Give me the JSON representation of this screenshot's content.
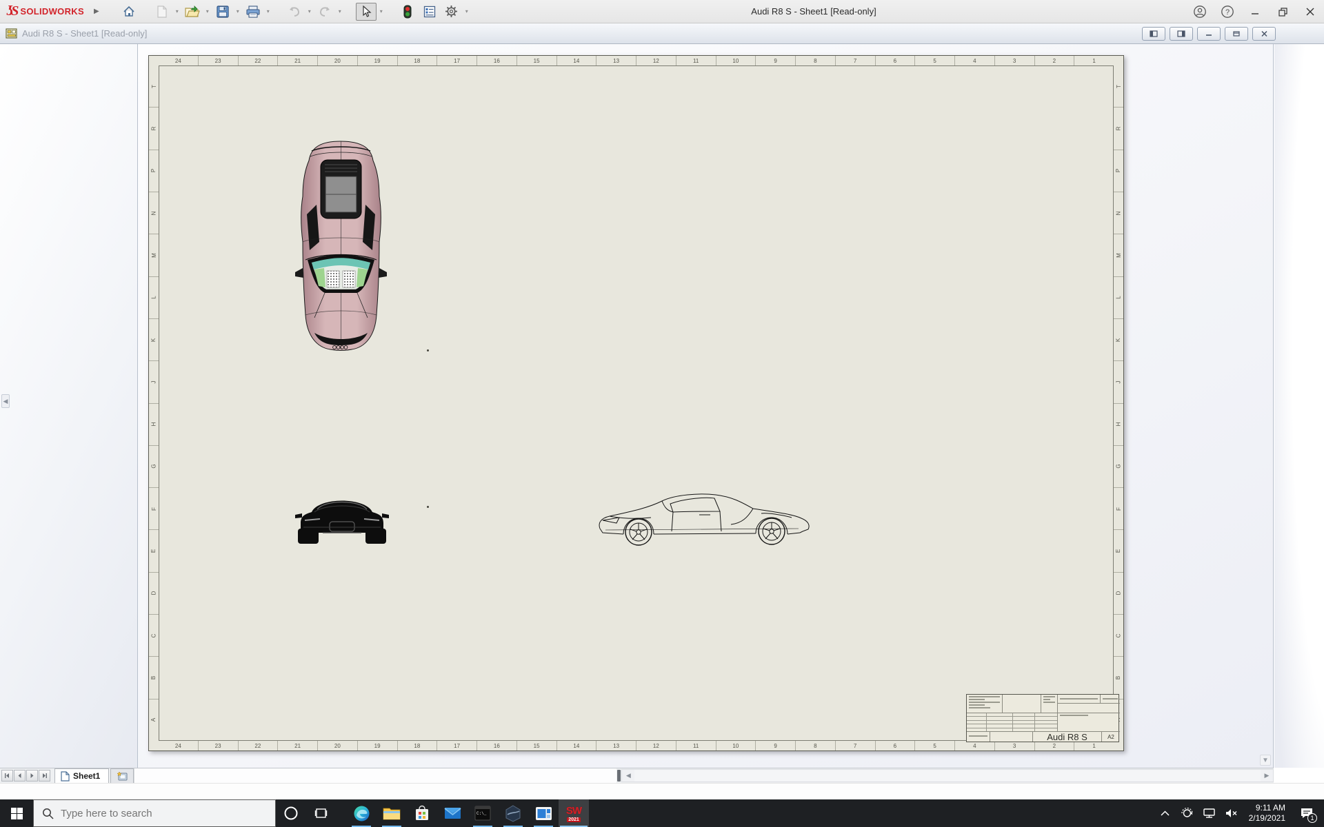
{
  "window": {
    "logo_text": "SOLIDWORKS",
    "title": "Audi R8 S - Sheet1 [Read-only]"
  },
  "document_window": {
    "title": "Audi R8 S - Sheet1 [Read-only]"
  },
  "toolbar_icons": [
    "home-icon",
    "new-document-icon",
    "open-folder-icon",
    "save-icon",
    "print-icon",
    "undo-icon",
    "redo-icon",
    "select-arrow-icon",
    "stoplight-icon",
    "properties-icon",
    "gear-icon"
  ],
  "drawing": {
    "zone_numbers": [
      "24",
      "23",
      "22",
      "21",
      "20",
      "19",
      "18",
      "17",
      "16",
      "15",
      "14",
      "13",
      "12",
      "11",
      "10",
      "9",
      "8",
      "7",
      "6",
      "5",
      "4",
      "3",
      "2",
      "1"
    ],
    "zone_letters": [
      "T",
      "R",
      "P",
      "N",
      "M",
      "L",
      "K",
      "J",
      "H",
      "G",
      "F",
      "E",
      "D",
      "C",
      "B",
      "A"
    ],
    "views": [
      "top-view",
      "front-view",
      "side-view"
    ],
    "title_block": {
      "part_name": "Audi R8 S",
      "sheet_size": "A2"
    }
  },
  "sheet_tabs": {
    "active_tab": "Sheet1"
  },
  "taskbar": {
    "search_placeholder": "Type here to search",
    "app_icons": [
      "edge",
      "file-explorer",
      "store",
      "mail",
      "terminal",
      "edrawings",
      "media-app",
      "solidworks"
    ],
    "solidworks_label": "SW",
    "solidworks_year": "2021",
    "clock_time": "9:11 AM",
    "clock_date": "2/19/2021",
    "notification_count": "1"
  },
  "colors": {
    "sheet_paper": "#e8e7dd",
    "car_body": "#cfa9ae",
    "taskbar_bg": "#1e2023",
    "running_indicator": "#76b9ed",
    "logo_red": "#d2232a"
  }
}
